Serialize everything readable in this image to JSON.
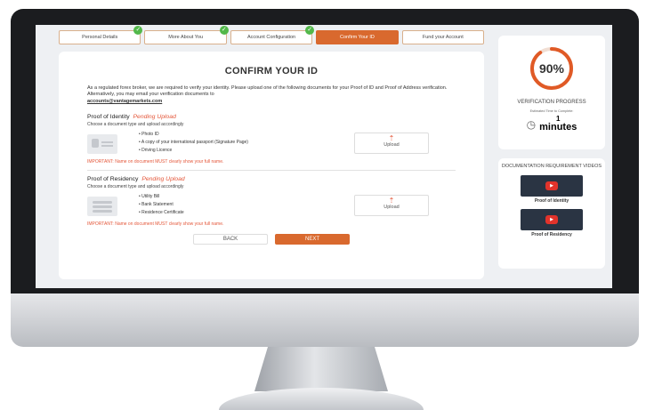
{
  "steps": [
    {
      "label": "Personal Details",
      "done": true
    },
    {
      "label": "More About You",
      "done": true
    },
    {
      "label": "Account Configuration",
      "done": true
    },
    {
      "label": "Confirm Your ID",
      "active": true
    },
    {
      "label": "Fund your Account"
    }
  ],
  "main": {
    "title": "CONFIRM YOUR ID",
    "intro": "As a regulated forex broker, we are required to verify your identity. Please upload one of the following documents for your Proof of ID and Proof of Address verification. Alternatively, you may email your verification documents to",
    "email": "accounts@vantagemarkets.com"
  },
  "identity": {
    "heading": "Proof of Identity",
    "status": "Pending Upload",
    "sub": "Choose a document type and upload accordingly",
    "items": [
      "Photo ID",
      "A copy of your international passport (Signature Page)",
      "Driving Licence"
    ],
    "upload_label": "Upload",
    "important": "IMPORTANT: Name on document MUST clearly show your full name."
  },
  "residency": {
    "heading": "Proof of Residency",
    "status": "Pending Upload",
    "sub": "Choose a document type and upload accordingly",
    "items": [
      "Utility Bill",
      "Bank Statement",
      "Residence Certificate"
    ],
    "upload_label": "Upload",
    "important": "IMPORTANT: Name on document MUST clearly show your full name."
  },
  "buttons": {
    "back": "BACK",
    "next": "NEXT"
  },
  "progress": {
    "percent": 90,
    "percent_label": "90%",
    "label": "VERIFICATION PROGRESS",
    "estimate": "Estimated Time to Complete:",
    "time_value": "1",
    "time_unit": "minutes"
  },
  "videos": {
    "title": "DOCUMENTATION REQUIREMENT VIDEOS",
    "items": [
      {
        "caption": "Proof of Identity"
      },
      {
        "caption": "Proof of Residency"
      }
    ]
  },
  "colors": {
    "accent": "#d9692e",
    "pending": "#e4573a",
    "done": "#52b84a"
  },
  "icons": {
    "check": "check-icon",
    "upload": "upload-icon",
    "clock": "clock-icon",
    "play": "play-icon"
  }
}
